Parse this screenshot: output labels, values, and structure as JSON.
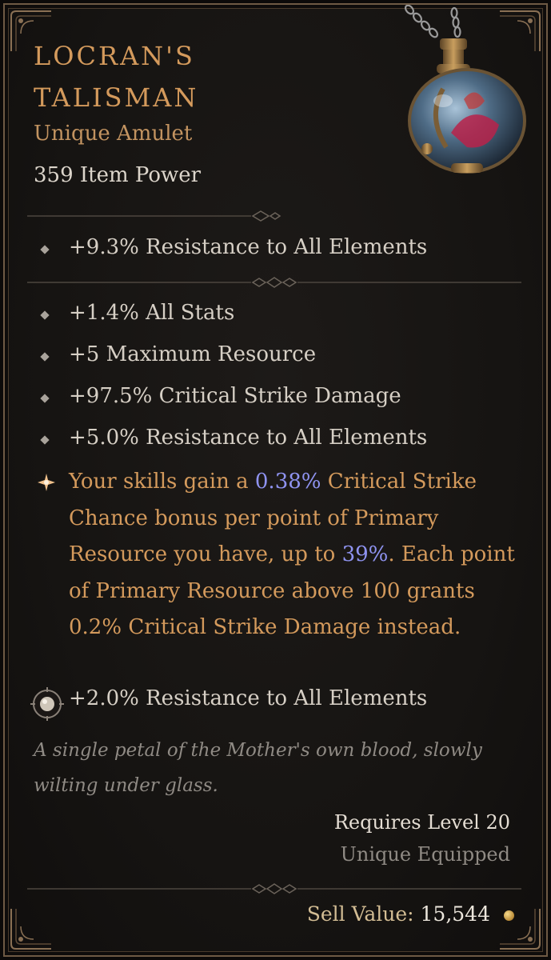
{
  "item": {
    "name": "Locran's Talisman",
    "type": "Unique Amulet",
    "power": "359 Item Power"
  },
  "implicit": {
    "stat": "+9.3% Resistance to All Elements"
  },
  "affixes": [
    "+1.4% All Stats",
    "+5 Maximum Resource",
    "+97.5% Critical Strike Damage",
    "+5.0% Resistance to All Elements"
  ],
  "unique_power": {
    "part1": "Your skills gain a ",
    "value1": "0.38%",
    "part2": " Critical Strike Chance bonus per point of Primary Resource you have, up to ",
    "value2": "39%",
    "part3": ". Each point of Primary Resource above 100 grants 0.2% Critical Strike Damage instead."
  },
  "socket": {
    "stat": "+2.0% Resistance to All Elements"
  },
  "flavor_text": "A single petal of the Mother's own blood, slowly wilting under glass.",
  "requirements": {
    "level": "Requires Level 20",
    "equip": "Unique Equipped"
  },
  "sell": {
    "label": "Sell Value:",
    "value": "15,544"
  },
  "colors": {
    "unique_orange": "#d49a5c",
    "highlight_blue": "#8f93f0",
    "flavor_grey": "#8f8a84"
  },
  "icons": {
    "item": "amulet-potion-icon",
    "bullet": "diamond-bullet-icon",
    "unique": "star-burst-icon",
    "socket": "gem-socket-icon",
    "currency": "gold-coin-icon"
  }
}
